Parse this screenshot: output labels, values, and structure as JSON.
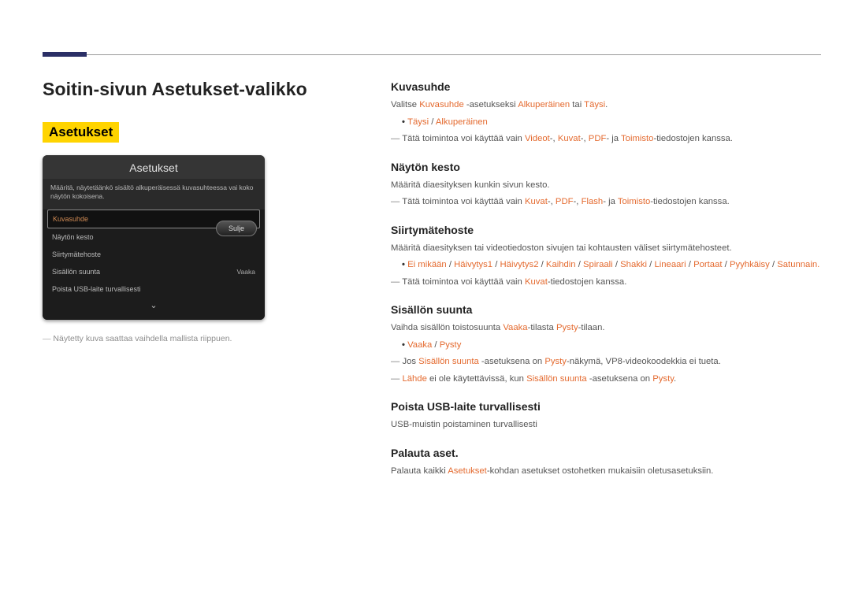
{
  "pageTitle": "Soitin-sivun Asetukset-valikko",
  "sectionLabel": "Asetukset",
  "panel": {
    "title": "Asetukset",
    "subtitle": "Määritä, näytetäänkö sisältö alkuperäisessä kuvasuhteessa vai koko näytön kokoisena.",
    "items": [
      {
        "label": "Kuvasuhde",
        "value": ""
      },
      {
        "label": "Näytön kesto",
        "value": ""
      },
      {
        "label": "Siirtymätehoste",
        "value": ""
      },
      {
        "label": "Sisällön suunta",
        "value": "Vaaka"
      },
      {
        "label": "Poista USB-laite turvallisesti",
        "value": ""
      }
    ],
    "close": "Sulje"
  },
  "footnote": "Näytetty kuva saattaa vaihdella mallista riippuen.",
  "right": {
    "kuvasuhde": {
      "h": "Kuvasuhde",
      "p1a": "Valitse ",
      "p1b": "Kuvasuhde",
      "p1c": " -asetukseksi ",
      "p1d": "Alkuperäinen",
      "p1e": " tai ",
      "p1f": "Täysi",
      "p1g": ".",
      "b1": "Täysi",
      "b2": "Alkuperäinen",
      "d1a": "Tätä toimintoa voi käyttää vain ",
      "d1v": "Videot",
      "d1s1": "-, ",
      "d1k": "Kuvat",
      "d1s2": "-, ",
      "d1p": "PDF",
      "d1s3": "- ja ",
      "d1t": "Toimisto",
      "d1e": "-tiedostojen kanssa."
    },
    "nayton": {
      "h": "Näytön kesto",
      "p": "Määritä diaesityksen kunkin sivun kesto.",
      "d1a": "Tätä toimintoa voi käyttää vain ",
      "d1k": "Kuvat",
      "d1s1": "-, ",
      "d1p": "PDF",
      "d1s2": "-, ",
      "d1f": "Flash",
      "d1s3": "- ja ",
      "d1t": "Toimisto",
      "d1e": "-tiedostojen kanssa."
    },
    "siirt": {
      "h": "Siirtymätehoste",
      "p": "Määritä diaesityksen tai videotiedoston sivujen tai kohtausten väliset siirtymätehosteet.",
      "opts": [
        "Ei mikään",
        "Häivytys1",
        "Häivytys2",
        "Kaihdin",
        "Spiraali",
        "Shakki",
        "Lineaari",
        "Portaat",
        "Pyyhkäisy",
        "Satunnain."
      ],
      "d1a": "Tätä toimintoa voi käyttää vain ",
      "d1k": "Kuvat",
      "d1e": "-tiedostojen kanssa."
    },
    "sisallon": {
      "h": "Sisällön suunta",
      "p1a": "Vaihda sisällön toistosuunta ",
      "p1b": "Vaaka",
      "p1c": "-tilasta ",
      "p1d": "Pysty",
      "p1e": "-tilaan.",
      "b1": "Vaaka",
      "b2": "Pysty",
      "d1a": "Jos ",
      "d1b": "Sisällön suunta",
      "d1c": " -asetuksena on ",
      "d1d": "Pysty",
      "d1e": "-näkymä, VP8-videokoodekkia ei tueta.",
      "d2a": "Lähde",
      "d2b": " ei ole käytettävissä, kun ",
      "d2c": "Sisällön suunta",
      "d2d": " -asetuksena on ",
      "d2e": "Pysty",
      "d2f": "."
    },
    "usb": {
      "h": "Poista USB-laite turvallisesti",
      "p": "USB-muistin poistaminen turvallisesti"
    },
    "palauta": {
      "h": "Palauta aset.",
      "p1a": "Palauta kaikki ",
      "p1b": "Asetukset",
      "p1c": "-kohdan asetukset ostohetken mukaisiin oletusasetuksiin."
    }
  }
}
